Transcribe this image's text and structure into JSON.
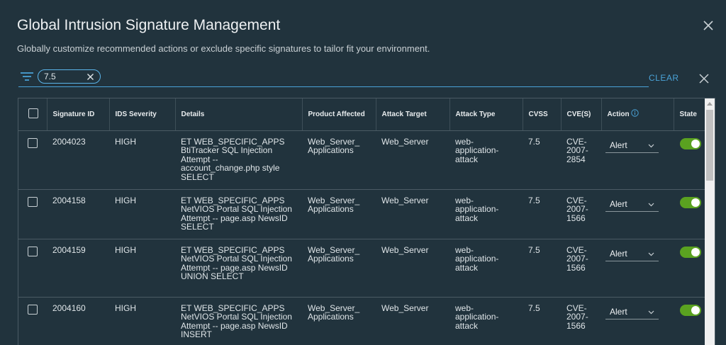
{
  "dialog": {
    "title": "Global Intrusion Signature Management",
    "subtitle": "Globally customize recommended actions or exclude specific signatures to tailor fit your environment."
  },
  "filter": {
    "chip_value": "7.5",
    "clear_label": "CLEAR"
  },
  "table": {
    "headers": {
      "signature_id": "Signature ID",
      "ids_severity": "IDS Severity",
      "details": "Details",
      "product_affected": "Product Affected",
      "attack_target": "Attack Target",
      "attack_type": "Attack Type",
      "cvss": "CVSS",
      "cves": "CVE(S)",
      "action": "Action",
      "state": "State"
    },
    "rows": [
      {
        "signature_id": "2004023",
        "severity": "HIGH",
        "details": "ET WEB_SPECIFIC_APPS BtiTracker SQL Injection Attempt -- account_change.php style SELECT",
        "product_affected": "Web_Server_ Applications",
        "attack_target": "Web_Server",
        "attack_type": "web-application-attack",
        "cvss": "7.5",
        "cves": "CVE-2007-2854",
        "action": "Alert",
        "state": "on"
      },
      {
        "signature_id": "2004158",
        "severity": "HIGH",
        "details": "ET WEB_SPECIFIC_APPS NetVIOS Portal SQL Injection Attempt -- page.asp NewsID SELECT",
        "product_affected": "Web_Server_ Applications",
        "attack_target": "Web_Server",
        "attack_type": "web-application-attack",
        "cvss": "7.5",
        "cves": "CVE-2007-1566",
        "action": "Alert",
        "state": "on"
      },
      {
        "signature_id": "2004159",
        "severity": "HIGH",
        "details": "ET WEB_SPECIFIC_APPS NetVIOS Portal SQL Injection Attempt -- page.asp NewsID UNION SELECT",
        "product_affected": "Web_Server_ Applications",
        "attack_target": "Web_Server",
        "attack_type": "web-application-attack",
        "cvss": "7.5",
        "cves": "CVE-2007-1566",
        "action": "Alert",
        "state": "on"
      },
      {
        "signature_id": "2004160",
        "severity": "HIGH",
        "details": "ET WEB_SPECIFIC_APPS NetVIOS Portal SQL Injection Attempt -- page.asp NewsID INSERT",
        "product_affected": "Web_Server_ Applications",
        "attack_target": "Web_Server",
        "attack_type": "web-application-attack",
        "cvss": "7.5",
        "cves": "CVE-2007-1566",
        "action": "Alert",
        "state": "on"
      }
    ]
  },
  "colors": {
    "background": "#21333d",
    "accent": "#4aa3d8",
    "toggle_on": "#5aa220"
  }
}
